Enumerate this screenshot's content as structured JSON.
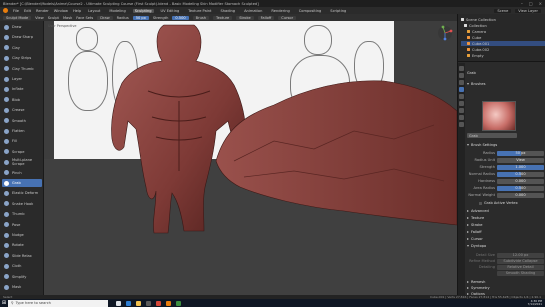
{
  "window": {
    "title": "Blender* [C:\\Blender\\Models\\Anime\\Course2 - Ultimate Sculpting Course (First Sculpt).blend - Basic Modeling Skin Modifier Stomach Sculpted]"
  },
  "menubar": {
    "menus": [
      "File",
      "Edit",
      "Render",
      "Window",
      "Help"
    ],
    "workspaces": [
      "Layout",
      "Modeling",
      "Sculpting",
      "UV Editing",
      "Texture Paint",
      "Shading",
      "Animation",
      "Rendering",
      "Compositing",
      "Scripting"
    ],
    "active_workspace": "Sculpting",
    "scene": "Scene",
    "view_layer": "View Layer"
  },
  "header": {
    "mode": "Sculpt Mode",
    "items": [
      "View",
      "Sculpt",
      "Mask",
      "Face Sets"
    ],
    "brush": "Draw",
    "radius_label": "Radius",
    "radius_value": "50 px",
    "strength_label": "Strength",
    "strength_value": "0.500",
    "options": [
      "Brush",
      "Texture",
      "Stroke",
      "Falloff",
      "Cursor"
    ]
  },
  "toolbar": {
    "tools": [
      {
        "name": "Draw",
        "active": false
      },
      {
        "name": "Draw Sharp",
        "active": false
      },
      {
        "name": "Clay",
        "active": false
      },
      {
        "name": "Clay Strips",
        "active": false
      },
      {
        "name": "Clay Thumb",
        "active": false
      },
      {
        "name": "Layer",
        "active": false
      },
      {
        "name": "Inflate",
        "active": false
      },
      {
        "name": "Blob",
        "active": false
      },
      {
        "name": "Crease",
        "active": false
      },
      {
        "name": "Smooth",
        "active": false
      },
      {
        "name": "Flatten",
        "active": false
      },
      {
        "name": "Fill",
        "active": false
      },
      {
        "name": "Scrape",
        "active": false
      },
      {
        "name": "Multi-plane Scrape",
        "active": false
      },
      {
        "name": "Pinch",
        "active": false
      },
      {
        "name": "Grab",
        "active": true
      },
      {
        "name": "Elastic Deform",
        "active": false
      },
      {
        "name": "Snake Hook",
        "active": false
      },
      {
        "name": "Thumb",
        "active": false
      },
      {
        "name": "Pose",
        "active": false
      },
      {
        "name": "Nudge",
        "active": false
      },
      {
        "name": "Rotate",
        "active": false
      },
      {
        "name": "Slide Relax",
        "active": false
      },
      {
        "name": "Cloth",
        "active": false
      },
      {
        "name": "Simplify",
        "active": false
      },
      {
        "name": "Mask",
        "active": false
      }
    ]
  },
  "viewport": {
    "label": "User Perspective",
    "sublabel": "(1) Cube.001"
  },
  "outliner": {
    "items": [
      {
        "name": "Scene Collection",
        "type": "collection",
        "selected": false
      },
      {
        "name": "Collection",
        "type": "collection",
        "selected": false
      },
      {
        "name": "Camera",
        "type": "camera",
        "selected": false
      },
      {
        "name": "Cube",
        "type": "mesh",
        "selected": false
      },
      {
        "name": "Cube.001",
        "type": "mesh",
        "selected": true
      },
      {
        "name": "Cube.002",
        "type": "mesh",
        "selected": false
      },
      {
        "name": "Empty",
        "type": "empty",
        "selected": false
      }
    ]
  },
  "properties": {
    "tool_name": "Grab",
    "brushes_header": "Brushes",
    "brush_name": "Grab",
    "brush_settings_header": "Brush Settings",
    "fields": [
      {
        "label": "Radius",
        "value": "50 px",
        "fill": 0.5
      },
      {
        "label": "Radius Unit",
        "value": "View",
        "fill": 0
      },
      {
        "label": "Strength",
        "value": "1.000",
        "fill": 1.0
      },
      {
        "label": "Normal Radius",
        "value": "0.500",
        "fill": 0.5
      },
      {
        "label": "Hardness",
        "value": "0.000",
        "fill": 0
      },
      {
        "label": "Area Radius",
        "value": "0.500",
        "fill": 0.5
      },
      {
        "label": "Normal Weight",
        "value": "0.000",
        "fill": 0
      }
    ],
    "checkbox_label": "Grab Active Vertex",
    "sections": [
      "Advanced",
      "Texture",
      "Stroke",
      "Falloff",
      "Cursor",
      "Dyntopo"
    ],
    "dyntopo_fields": [
      {
        "label": "Detail Size",
        "value": "12.00 px"
      },
      {
        "label": "Refine Method",
        "value": "Subdivide Collapse"
      },
      {
        "label": "Detailing",
        "value": "Relative Detail"
      },
      {
        "label": "",
        "value": "Smooth Shading"
      }
    ],
    "bottom_sections": [
      "Remesh",
      "Symmetry",
      "Options"
    ]
  },
  "statusbar": {
    "left": "Select",
    "right": "Cube.001 | Verts 27,816 | Faces 27,814 | Tris 55,628 | Objects 1/4 | 2.90.1"
  },
  "taskbar": {
    "search_placeholder": "Type here to search",
    "time": "4:36 PM",
    "date": "7/14/2021"
  }
}
